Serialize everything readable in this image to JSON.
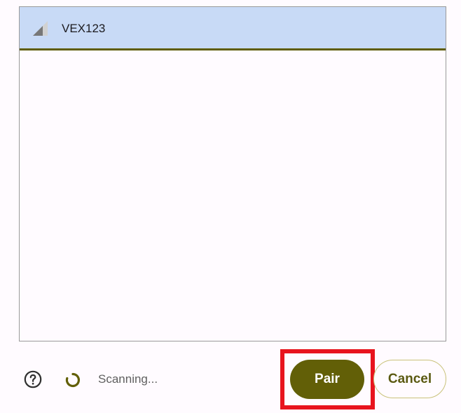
{
  "devices": [
    {
      "name": "VEX123",
      "icon": "signal-strength-icon",
      "selected": true
    }
  ],
  "footer": {
    "help_icon": "help-circle-icon",
    "spinner_icon": "loading-spinner-icon",
    "status_text": "Scanning...",
    "pair_label": "Pair",
    "cancel_label": "Cancel"
  },
  "colors": {
    "selected_row": "#c8daf6",
    "accent": "#625f07",
    "highlight": "#e8141e",
    "background": "#fffbff"
  }
}
